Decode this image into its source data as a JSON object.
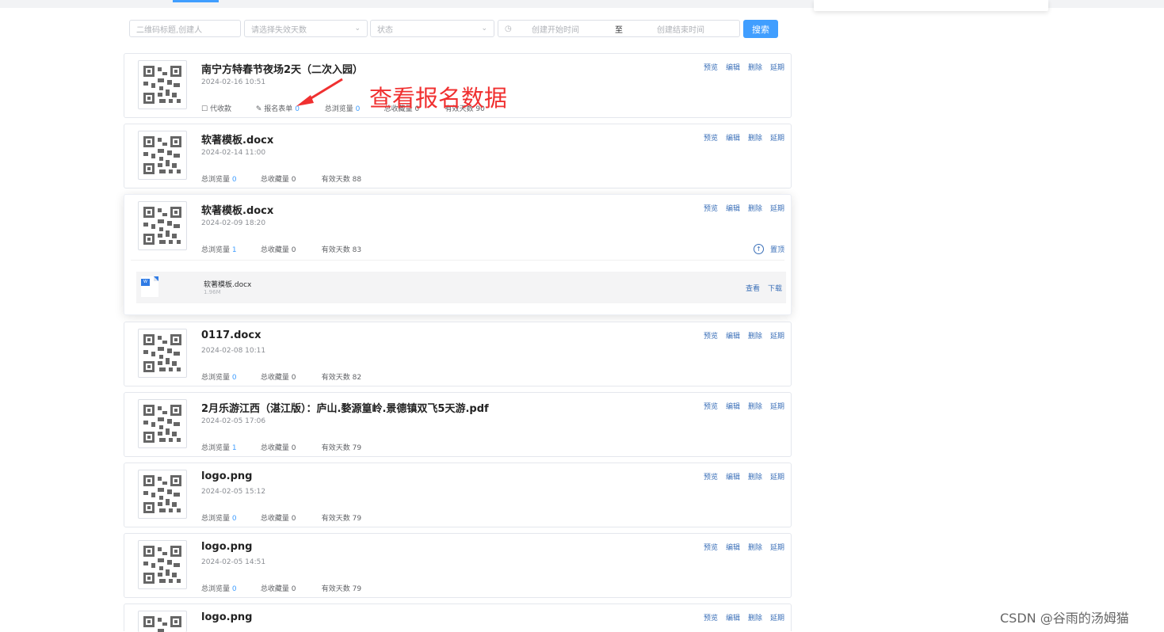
{
  "filters": {
    "search_placeholder": "二维码标题,创建人",
    "days_placeholder": "请选择失效天数",
    "status_placeholder": "状态",
    "start_time_placeholder": "创建开始时间",
    "range_separator": "至",
    "end_time_placeholder": "创建结束时间",
    "search_button": "搜索"
  },
  "card_actions": {
    "preview": "预览",
    "edit": "编辑",
    "delete": "删除",
    "extend": "延期"
  },
  "cards": [
    {
      "title": "南宁方特春节夜场2天（二次入园）",
      "date": "2024-02-16 10:51",
      "collect_label": "代收款",
      "form_label": "报名表单",
      "form_value": "0",
      "views_label": "总浏览量",
      "views_value": "0",
      "favs_label": "总收藏量",
      "favs_value": "0",
      "days_label": "有效天数",
      "days_value": "90"
    },
    {
      "title": "软著模板.docx",
      "date": "2024-02-14 11:00",
      "views_label": "总浏览量",
      "views_value": "0",
      "favs_label": "总收藏量",
      "favs_value": "0",
      "days_label": "有效天数",
      "days_value": "88"
    },
    {
      "title": "软著模板.docx",
      "date": "2024-02-09 18:20",
      "views_label": "总浏览量",
      "views_value": "1",
      "favs_label": "总收藏量",
      "favs_value": "0",
      "days_label": "有效天数",
      "days_value": "83",
      "pin_label": "置顶",
      "file": {
        "name": "软著模板.docx",
        "size": "1.96M",
        "view": "查看",
        "download": "下载"
      }
    },
    {
      "title": "0117.docx",
      "date": "2024-02-08 10:11",
      "views_label": "总浏览量",
      "views_value": "0",
      "favs_label": "总收藏量",
      "favs_value": "0",
      "days_label": "有效天数",
      "days_value": "82"
    },
    {
      "title": "2月乐游江西（湛江版）：庐山.婺源篁岭.景德镇双飞5天游.pdf",
      "date": "2024-02-05 17:06",
      "views_label": "总浏览量",
      "views_value": "1",
      "favs_label": "总收藏量",
      "favs_value": "0",
      "days_label": "有效天数",
      "days_value": "79"
    },
    {
      "title": "logo.png",
      "date": "2024-02-05 15:12",
      "views_label": "总浏览量",
      "views_value": "0",
      "favs_label": "总收藏量",
      "favs_value": "0",
      "days_label": "有效天数",
      "days_value": "79"
    },
    {
      "title": "logo.png",
      "date": "2024-02-05 14:51",
      "views_label": "总浏览量",
      "views_value": "0",
      "favs_label": "总收藏量",
      "favs_value": "0",
      "days_label": "有效天数",
      "days_value": "79"
    },
    {
      "title": "logo.png"
    }
  ],
  "annotation": "查看报名数据",
  "watermark": "CSDN @谷雨的汤姆猫",
  "colors": {
    "accent": "#409eff",
    "action_link": "#3a6fb8",
    "annotation": "#f03030"
  }
}
